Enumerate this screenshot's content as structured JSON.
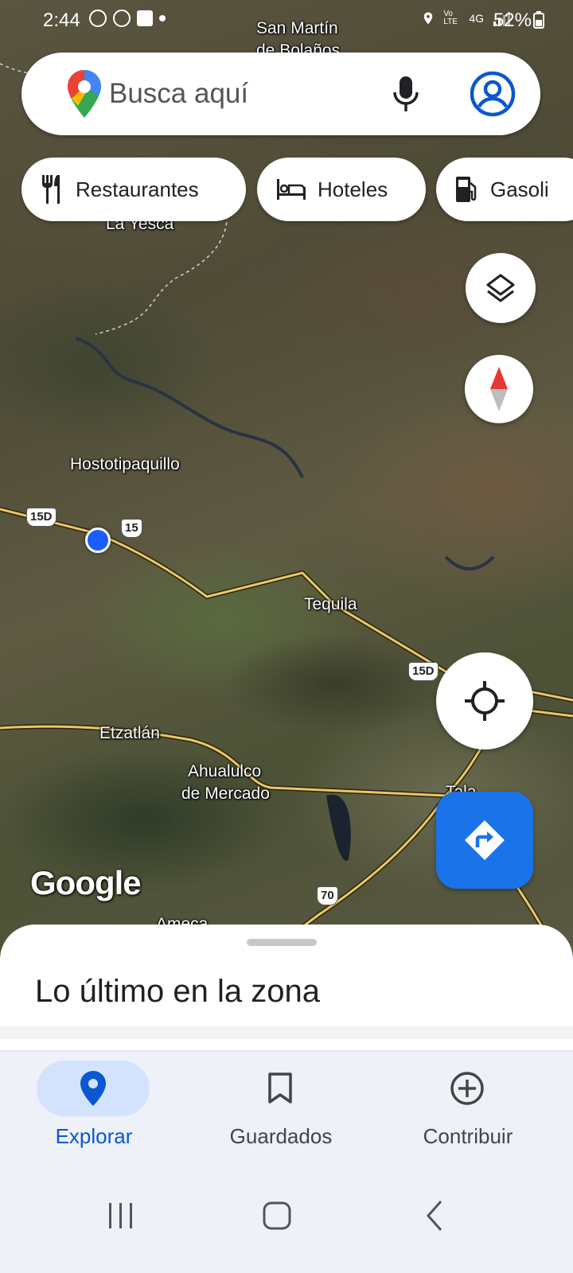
{
  "status_bar": {
    "time": "2:44",
    "network": "4G",
    "volte": "Vo LTE",
    "battery": "52%"
  },
  "search": {
    "placeholder": "Busca aquí"
  },
  "chips": [
    {
      "label": "Restaurantes",
      "icon": "restaurant-icon"
    },
    {
      "label": "Hoteles",
      "icon": "hotel-icon"
    },
    {
      "label": "Gasoli",
      "icon": "gas-station-icon"
    }
  ],
  "map": {
    "labels": {
      "san_martin": "San Martín",
      "de_bolanos": "de Bolaños",
      "la_yesca": "La Yesca",
      "hostotipaquillo": "Hostotipaquillo",
      "tequila": "Tequila",
      "etzatlan": "Etzatlán",
      "ahualulco": "Ahualulco",
      "de_mercado": "de Mercado",
      "ameca": "Ameca",
      "tala": "Tala"
    },
    "shields": {
      "s1": "15D",
      "s2": "15",
      "s3": "15D",
      "s4": "70"
    },
    "logo": "Google"
  },
  "sheet": {
    "title": "Lo último en la zona"
  },
  "bottom_nav": [
    {
      "label": "Explorar",
      "icon": "explore-pin-icon",
      "active": true
    },
    {
      "label": "Guardados",
      "icon": "bookmark-icon",
      "active": false
    },
    {
      "label": "Contribuir",
      "icon": "add-circle-icon",
      "active": false
    }
  ],
  "colors": {
    "accent": "#1a73e8",
    "active_nav_bg": "#d3e3fd",
    "active_nav_text": "#0b57d0"
  }
}
